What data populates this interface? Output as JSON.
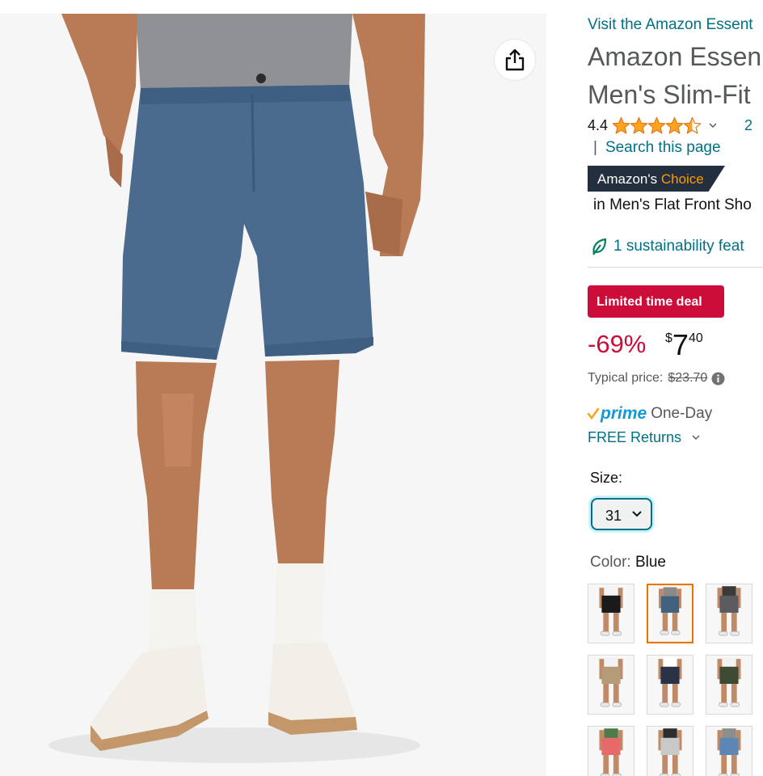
{
  "product": {
    "store_link": "Visit the Amazon Essent",
    "title_line1": "Amazon Essen",
    "title_line2": "Men's Slim-Fit",
    "rating": "4.4",
    "stars": [
      "full",
      "full",
      "full",
      "full",
      "half"
    ],
    "reviews_count": "2",
    "search_link": "Search this page",
    "badge": {
      "prefix": "Amazon's",
      "highlight": "Choice",
      "category": "in Men's Flat Front Sho"
    },
    "sustainability": "1 sustainability feat"
  },
  "deal": {
    "label": "Limited time deal",
    "discount": "-69%",
    "price_symbol": "$",
    "price_whole": "7",
    "price_fraction": "40",
    "typical_label": "Typical price:",
    "typical_price": "$23.70"
  },
  "shipping": {
    "prime_logo": "prime",
    "prime_text": "One-Day",
    "returns": "FREE Returns"
  },
  "size": {
    "label": "Size:",
    "selected": "31"
  },
  "color": {
    "label": "Color:",
    "selected": "Blue",
    "swatches": [
      {
        "shorts": "#1a1a1a",
        "shirt": "#f4f4f4",
        "selected": false
      },
      {
        "shorts": "#41617f",
        "shirt": "#8a8a8a",
        "selected": true
      },
      {
        "shorts": "#5c5c60",
        "shirt": "#3a3a3a",
        "selected": false
      },
      {
        "shorts": "#b69b79",
        "shirt": "#f2f2f2",
        "selected": false
      },
      {
        "shorts": "#2a3246",
        "shirt": "#ffffff",
        "selected": false
      },
      {
        "shorts": "#3e4a33",
        "shirt": "#f2f2f2",
        "selected": false
      },
      {
        "shorts": "#e66a6a",
        "shirt": "#4f7a4a",
        "selected": false
      },
      {
        "shorts": "#c9c9c9",
        "shirt": "#2d2d2d",
        "selected": false
      },
      {
        "shorts": "#5c86b5",
        "shirt": "#8d8d8d",
        "selected": false
      }
    ]
  },
  "colors": {
    "link": "#007185",
    "deal_red": "#cc0c39",
    "star_orange": "#ffa41c",
    "badge_navy": "#232f3e",
    "badge_orange": "#ff9900",
    "prime_blue": "#1399d4",
    "selected_border": "#e77600"
  },
  "icons": {
    "share": "share-icon",
    "star": "star-icon",
    "chevron": "chevron-down-icon",
    "leaf": "leaf-icon",
    "info": "info-icon",
    "prime_check": "checkmark-icon"
  }
}
